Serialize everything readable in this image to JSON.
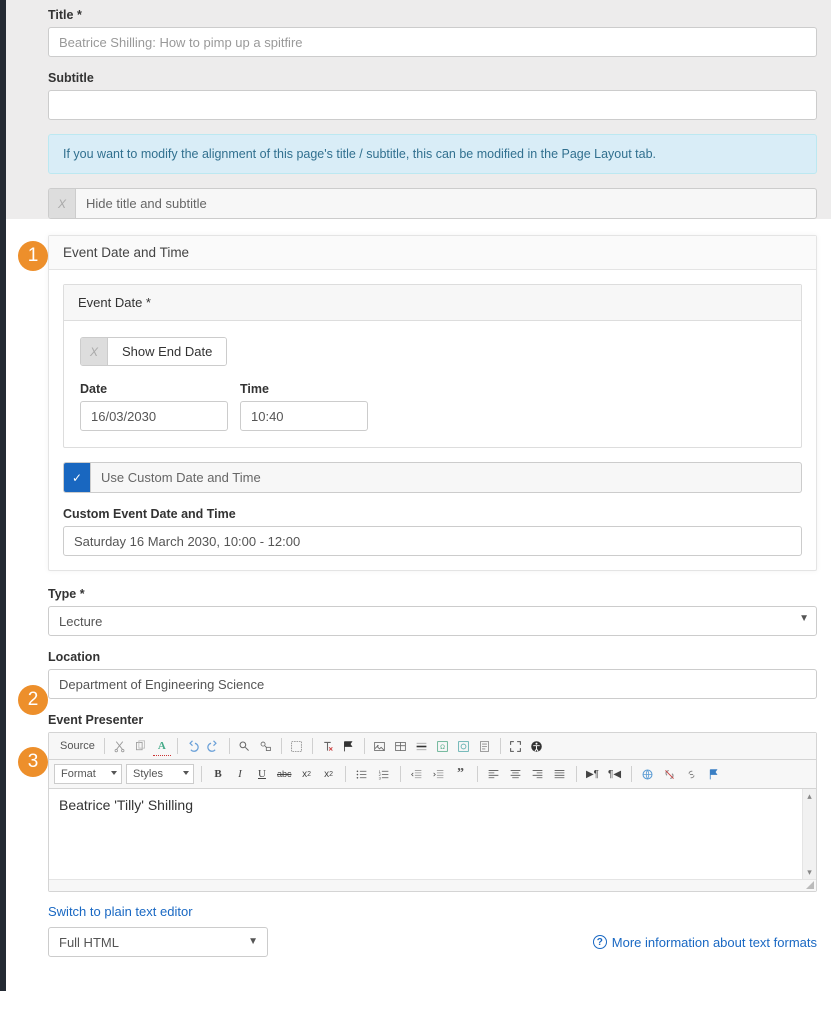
{
  "markers": [
    "1",
    "2",
    "3"
  ],
  "top": {
    "title_label": "Title",
    "title_placeholder": "Beatrice Shilling: How to pimp up a spitfire",
    "subtitle_label": "Subtitle",
    "subtitle_value": "",
    "alert": "If you want to modify the alignment of this page's title / subtitle, this can be modified in the Page Layout tab.",
    "hide_toggle_mark": "X",
    "hide_toggle_label": "Hide title and subtitle"
  },
  "datetime": {
    "section_title": "Event Date and Time",
    "eventdate_label": "Event Date *",
    "show_end_mark": "X",
    "show_end_label": "Show End Date",
    "date_label": "Date",
    "date_value": "16/03/2030",
    "time_label": "Time",
    "time_value": "10:40",
    "use_custom_mark": "✓",
    "use_custom_label": "Use Custom Date and Time",
    "custom_heading": "Custom Event Date and Time",
    "custom_value": "Saturday 16 March 2030, 10:00 - 12:00"
  },
  "type": {
    "label": "Type",
    "value": "Lecture"
  },
  "location": {
    "label": "Location",
    "value": "Department of Engineering Science"
  },
  "presenter": {
    "label": "Event Presenter",
    "source_label": "Source",
    "format_combo": "Format",
    "styles_combo": "Styles",
    "body": "Beatrice 'Tilly' Shilling",
    "switch_link": "Switch to plain text editor",
    "format_select": "Full HTML",
    "info_link": "More information about text formats"
  },
  "required": "*"
}
